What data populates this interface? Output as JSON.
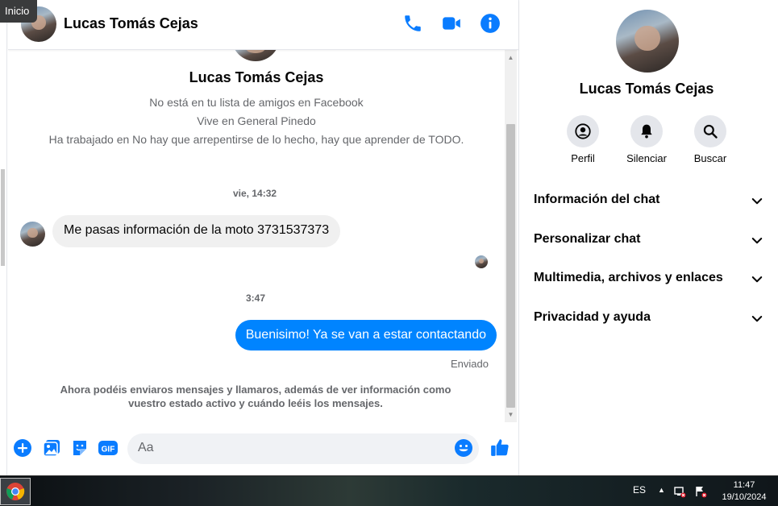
{
  "tooltip": {
    "text": "Inicio"
  },
  "header": {
    "contact_name": "Lucas Tomás Cejas",
    "icons": [
      "phone-icon",
      "video-camera-icon",
      "info-icon"
    ]
  },
  "intro": {
    "name": "Lucas Tomás Cejas",
    "line1": "No está en tu lista de amigos en Facebook",
    "line2": "Vive en General Pinedo",
    "line3": "Ha trabajado en No hay que arrepentirse de lo hecho, hay que aprender de TODO."
  },
  "messages": {
    "time1": "vie, 14:32",
    "incoming": "Me pasas información de la moto 3731537373",
    "time2": "3:47",
    "outgoing": "Buenisimo! Ya se van a estar contactando",
    "sent_status": "Enviado",
    "notice_line1": "Ahora podéis enviaros mensajes y llamaros, además de ver información como",
    "notice_line2": "vuestro estado activo y cuándo leéis los mensajes."
  },
  "composer": {
    "placeholder": "Aa",
    "gif_label": "GIF"
  },
  "right_panel": {
    "name": "Lucas Tomás Cejas",
    "actions": [
      {
        "label": "Perfil",
        "icon": "profile-icon"
      },
      {
        "label": "Silenciar",
        "icon": "bell-icon"
      },
      {
        "label": "Buscar",
        "icon": "search-icon"
      }
    ],
    "sections": [
      {
        "label": "Información del chat"
      },
      {
        "label": "Personalizar chat"
      },
      {
        "label": "Multimedia, archivos y enlaces"
      },
      {
        "label": "Privacidad y ayuda"
      }
    ]
  },
  "taskbar": {
    "language": "ES",
    "time": "11:47",
    "date": "19/10/2024"
  },
  "colors": {
    "accent": "#0084ff",
    "icon_blue": "#0a7cff",
    "incoming_bubble": "#f0f0f0",
    "secondary_text": "#65676b"
  }
}
